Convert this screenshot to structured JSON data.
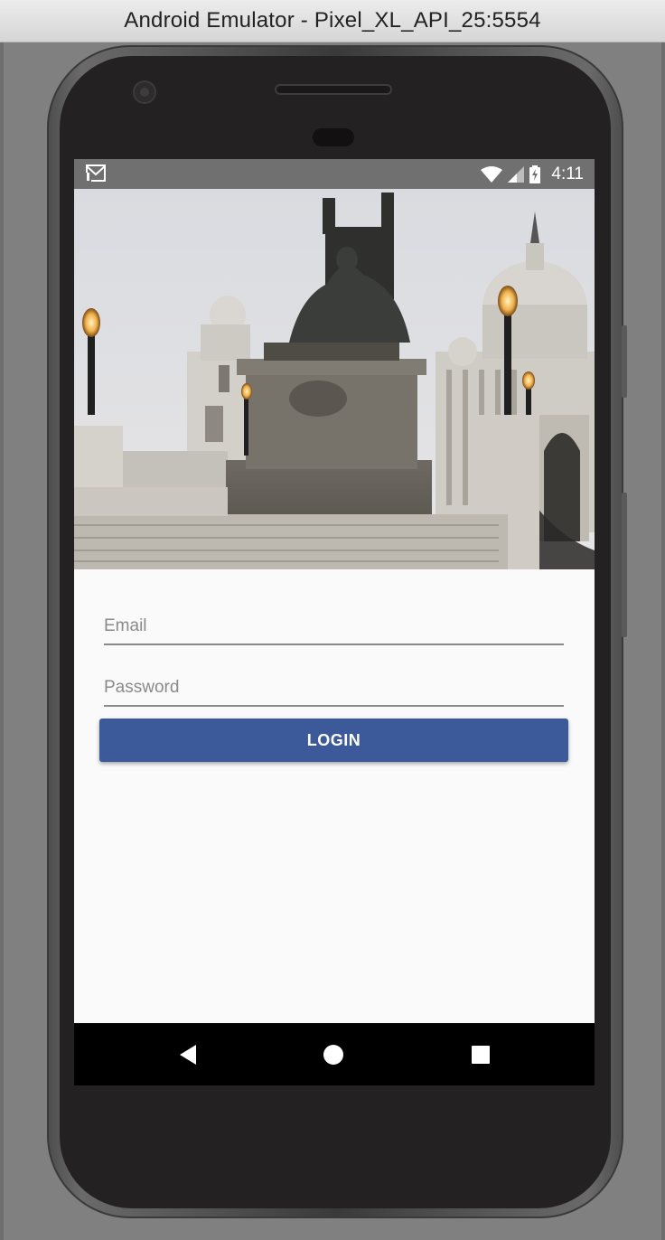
{
  "window": {
    "title": "Android Emulator - Pixel_XL_API_25:5554"
  },
  "status_bar": {
    "time": "4:11",
    "left_icon": "gmail-notification-icon",
    "right_icons": [
      "wifi-icon",
      "cell-signal-icon",
      "battery-charging-icon"
    ]
  },
  "hero_image": {
    "description_name": "victoria-memorial-statue-photo"
  },
  "login_form": {
    "email_placeholder": "Email",
    "email_value": "",
    "password_placeholder": "Password",
    "password_value": "",
    "login_label": "LOGIN"
  },
  "nav_bar": {
    "buttons": [
      "back-icon",
      "home-icon",
      "recents-icon"
    ]
  },
  "colors": {
    "button": "#3c5a99",
    "status_bar": "#707070",
    "screen_bg": "#fafafa"
  }
}
